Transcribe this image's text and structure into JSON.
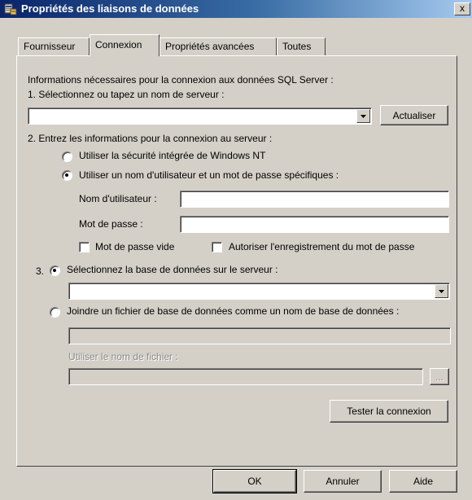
{
  "window": {
    "title": "Propriétés des liaisons de données",
    "close_glyph": "x",
    "titlebar_color": "#0a246a",
    "face_color": "#d4d0c8"
  },
  "tabs": [
    {
      "label": "Fournisseur",
      "active": false
    },
    {
      "label": "Connexion",
      "active": true
    },
    {
      "label": "Propriétés avancées",
      "active": false
    },
    {
      "label": "Toutes",
      "active": false
    }
  ],
  "connexion": {
    "intro": "Informations nécessaires pour la connexion aux données SQL Server :",
    "step1_label": "1. Sélectionnez ou tapez un nom de serveur :",
    "server_value": "",
    "refresh_button": "Actualiser",
    "step2_label": "2. Entrez les informations pour la connexion au serveur :",
    "auth_windows": {
      "label": "Utiliser la sécurité intégrée de Windows NT",
      "checked": false
    },
    "auth_sql": {
      "label": "Utiliser un nom d'utilisateur et un mot de passe spécifiques :",
      "checked": true
    },
    "username_label": "Nom d'utilisateur :",
    "username_value": "",
    "password_label": "Mot de passe :",
    "password_value": "",
    "blank_password": {
      "label": "Mot de passe vide",
      "checked": false
    },
    "allow_save": {
      "label": "Autoriser l'enregistrement du mot de passe",
      "checked": false
    },
    "step3_number": "3.",
    "select_db": {
      "label": "Sélectionnez la base de données sur le serveur :",
      "checked": true
    },
    "database_value": "",
    "attach_file": {
      "label": "Joindre un fichier de base de données comme un nom de base de données :",
      "checked": false
    },
    "attach_db_name_value": "",
    "filename_label": "Utiliser le nom de fichier :",
    "filename_value": "",
    "browse_button": "...",
    "test_button": "Tester la connexion"
  },
  "footer": {
    "ok_button": "OK",
    "cancel_button": "Annuler",
    "help_button": "Aide"
  }
}
